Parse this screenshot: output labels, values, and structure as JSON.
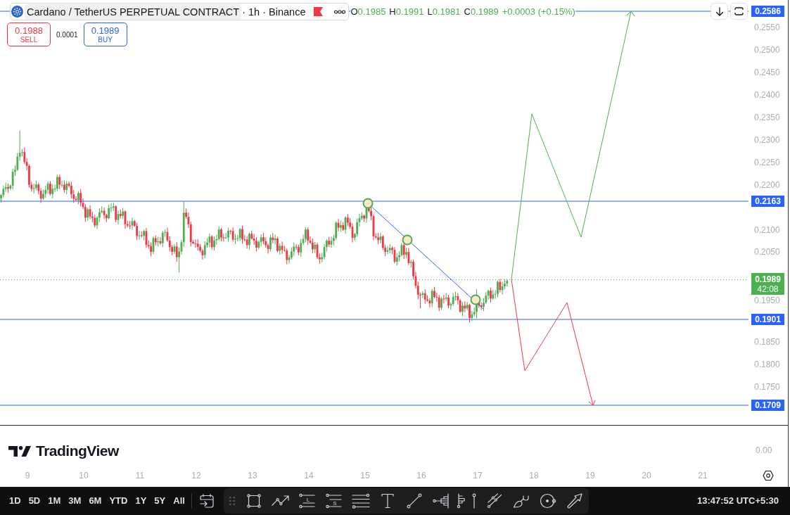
{
  "chart_header": {
    "symbol": "Cardano / TetherUS PERPETUAL CONTRACT",
    "interval": "· 1h · Binance",
    "ohlc": [
      {
        "key": "O",
        "value": "0.1985"
      },
      {
        "key": "H",
        "value": "0.1991"
      },
      {
        "key": "L",
        "value": "0.1981"
      },
      {
        "key": "C",
        "value": "0.1989"
      }
    ],
    "change": "+0.0003 (+0.15%)"
  },
  "trade_buttons": {
    "sell": {
      "price": "0.1988",
      "label": "SELL"
    },
    "spread": "0.0001",
    "buy": {
      "price": "0.1989",
      "label": "BUY"
    }
  },
  "price_axis": {
    "labels": [
      "0.2550",
      "0.2500",
      "0.2450",
      "0.2400",
      "0.2350",
      "0.2300",
      "0.2250",
      "0.2200",
      "0.2100",
      "0.2050",
      "0.1950",
      "0.1850",
      "0.1800",
      "0.1750"
    ]
  },
  "price_tags": [
    {
      "price": "0.2586"
    },
    {
      "price": "0.2163"
    },
    {
      "price": "0.1901"
    },
    {
      "price": "0.1709"
    }
  ],
  "last_price": {
    "price": "0.1989",
    "countdown": "42:08"
  },
  "indicator_pane": {
    "axis_label": "0.00"
  },
  "logo": {
    "text": "TradingView"
  },
  "time_axis": {
    "labels": [
      "9",
      "10",
      "11",
      "12",
      "13",
      "14",
      "15",
      "16",
      "17",
      "18",
      "19",
      "20",
      "21"
    ]
  },
  "bottom_toolbar": {
    "ranges": [
      "1D",
      "5D",
      "1M",
      "3M",
      "6M",
      "YTD",
      "1Y",
      "5Y",
      "All"
    ],
    "tool_letters": [
      "L",
      "S"
    ],
    "clock": "13:47:52 UTC+5:30"
  }
}
